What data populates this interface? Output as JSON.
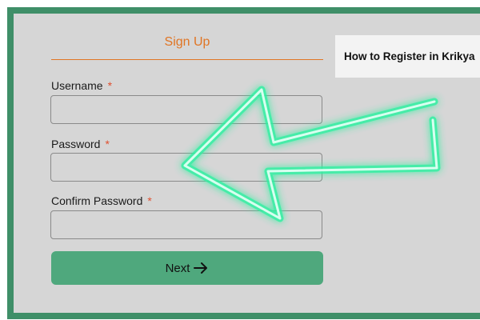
{
  "form": {
    "title": "Sign Up",
    "username_label": "Username",
    "password_label": "Password",
    "confirm_password_label": "Confirm Password",
    "required_marker": "*",
    "username_value": "",
    "password_value": "",
    "confirm_password_value": "",
    "next_label": "Next"
  },
  "sidebar_card": {
    "title": "How to Register in Krikya"
  },
  "colors": {
    "accent_orange": "#e07524",
    "border_green": "#3f8f68",
    "button_green": "#4fa87d",
    "arrow_glow": "#2ef0a0"
  },
  "icons": {
    "next": "arrow-right-icon",
    "overlay": "pointer-arrow-icon"
  }
}
